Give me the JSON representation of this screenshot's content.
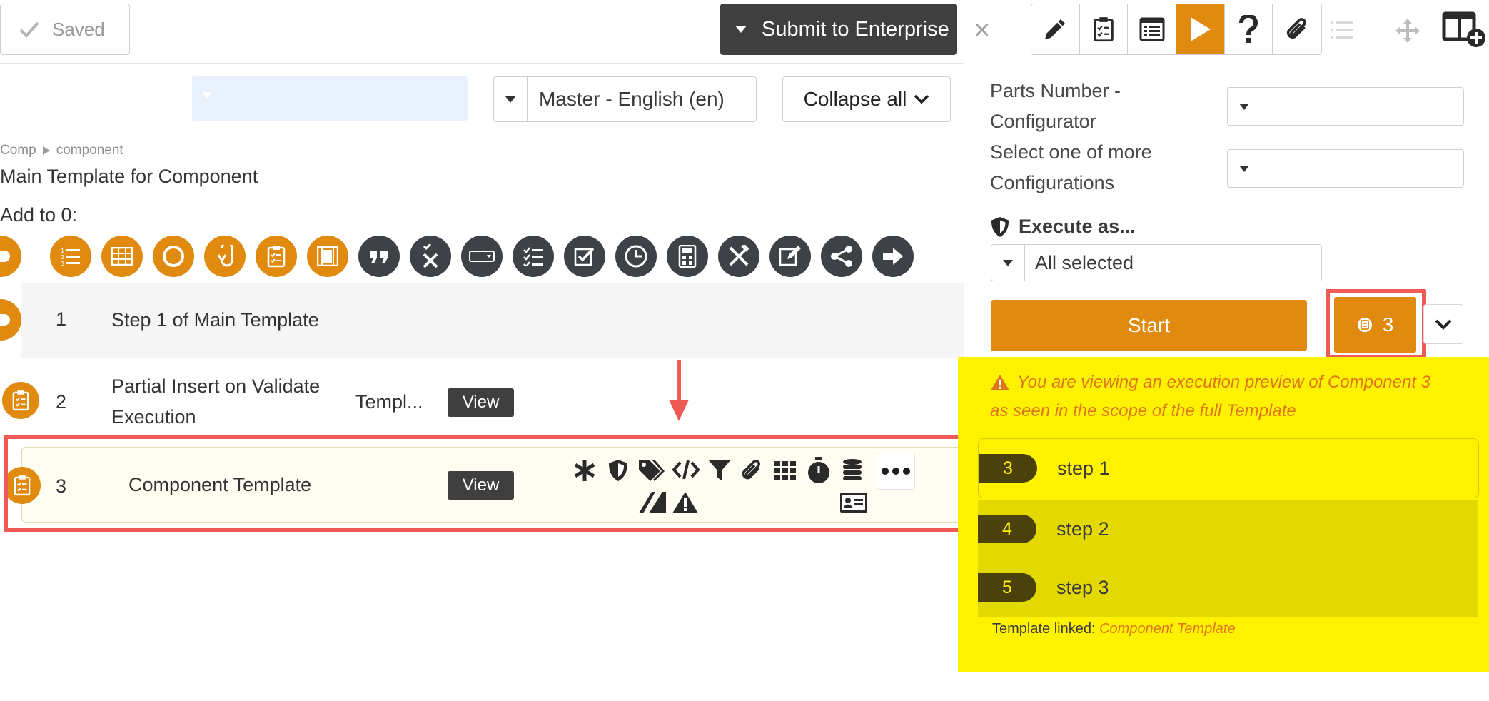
{
  "header": {
    "saved_label": "Saved",
    "submit_label": "Submit to Enterprise"
  },
  "controls": {
    "language_value": "Master - English (en)",
    "collapse_label": "Collapse all"
  },
  "breadcrumb": {
    "root": "Comp",
    "leaf": "component"
  },
  "page_title": "Main Template for Component",
  "add_to_label": "Add to 0:",
  "add_toolbar": {
    "icons": [
      "step-icon",
      "numbered-list-icon",
      "table-icon",
      "circle-icon",
      "link-icon",
      "checklist-icon",
      "film-icon",
      "quote-icon",
      "close-x-icon",
      "input-field-icon",
      "checklist-dark-icon",
      "checkbox-icon",
      "clock-icon",
      "calculator-icon",
      "tools-icon",
      "edit-icon",
      "share-icon",
      "arrow-right-icon"
    ]
  },
  "steps": [
    {
      "num": "1",
      "title": "Step 1 of Main Template"
    },
    {
      "num": "2",
      "title_line1": "Partial Insert on Validate",
      "title_line2": "Execution",
      "type": "Templ...",
      "view": "View"
    },
    {
      "num": "3",
      "title": "Component Template",
      "view": "View"
    }
  ],
  "row3_icons": [
    "asterisk-icon",
    "shield-icon",
    "tags-icon",
    "code-icon",
    "filter-icon",
    "paperclip-icon",
    "grid-icon",
    "stopwatch-icon",
    "database-icon",
    "more-icon",
    "parallel-icon",
    "warning-icon",
    "id-card-icon"
  ],
  "right_panel": {
    "close": "×",
    "toolbar": [
      "pencil-icon",
      "checklist-icon",
      "list-doc-icon",
      "play-icon",
      "question-icon",
      "paperclip-icon"
    ],
    "field1_label_line1": "Parts Number -",
    "field1_label_line2": "Configurator",
    "field2_label_line1": "Select one of more",
    "field2_label_line2": "Configurations",
    "execute_as_label": "Execute as...",
    "execute_as_value": "All selected",
    "start_label": "Start",
    "counter_value": "3",
    "warning_line1": "You are viewing an execution preview of Component 3",
    "warning_line2": "as seen in the scope of the full Template",
    "preview_steps": [
      {
        "num": "3",
        "label": "step 1"
      },
      {
        "num": "4",
        "label": "step 2"
      },
      {
        "num": "5",
        "label": "step 3"
      }
    ],
    "linked_prefix": "Template linked:",
    "linked_name": "Component Template"
  },
  "colors": {
    "accent": "#e08a10",
    "highlight": "#fff200",
    "annotation": "#ef5a55",
    "dark": "#3f3f3f"
  }
}
